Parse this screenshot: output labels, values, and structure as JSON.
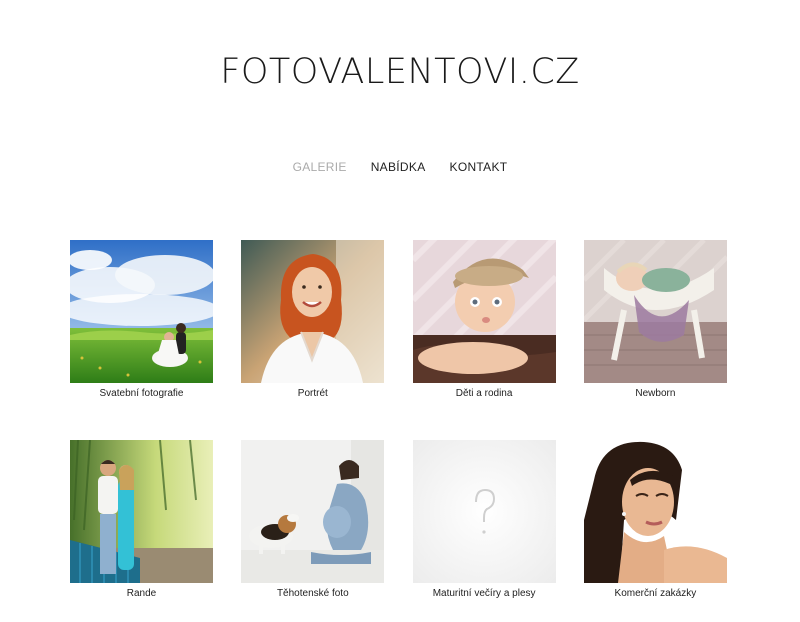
{
  "header": {
    "site_title": "FOTOVALENTOVI.CZ"
  },
  "nav": {
    "items": [
      {
        "label": "GALERIE",
        "active": true
      },
      {
        "label": "NABÍDKA",
        "active": false
      },
      {
        "label": "KONTAKT",
        "active": false
      }
    ]
  },
  "gallery": {
    "items": [
      {
        "caption": "Svatební fotografie",
        "image": "wedding-couple-meadow-image"
      },
      {
        "caption": "Portrét",
        "image": "redhead-woman-portrait-image"
      },
      {
        "caption": "Děti a rodina",
        "image": "baby-in-cap-image"
      },
      {
        "caption": "Newborn",
        "image": "sleeping-newborn-image"
      },
      {
        "caption": "Rande",
        "image": "couple-on-bridge-image"
      },
      {
        "caption": "Těhotenské foto",
        "image": "pregnant-woman-with-dog-image"
      },
      {
        "caption": "Maturitní večíry a plesy",
        "image": "placeholder-question-mark-image"
      },
      {
        "caption": "Komerční zakázky",
        "image": "woman-beauty-portrait-image"
      }
    ]
  },
  "colors": {
    "nav_active": "#aaaaaa",
    "text": "#222222",
    "background": "#ffffff"
  }
}
